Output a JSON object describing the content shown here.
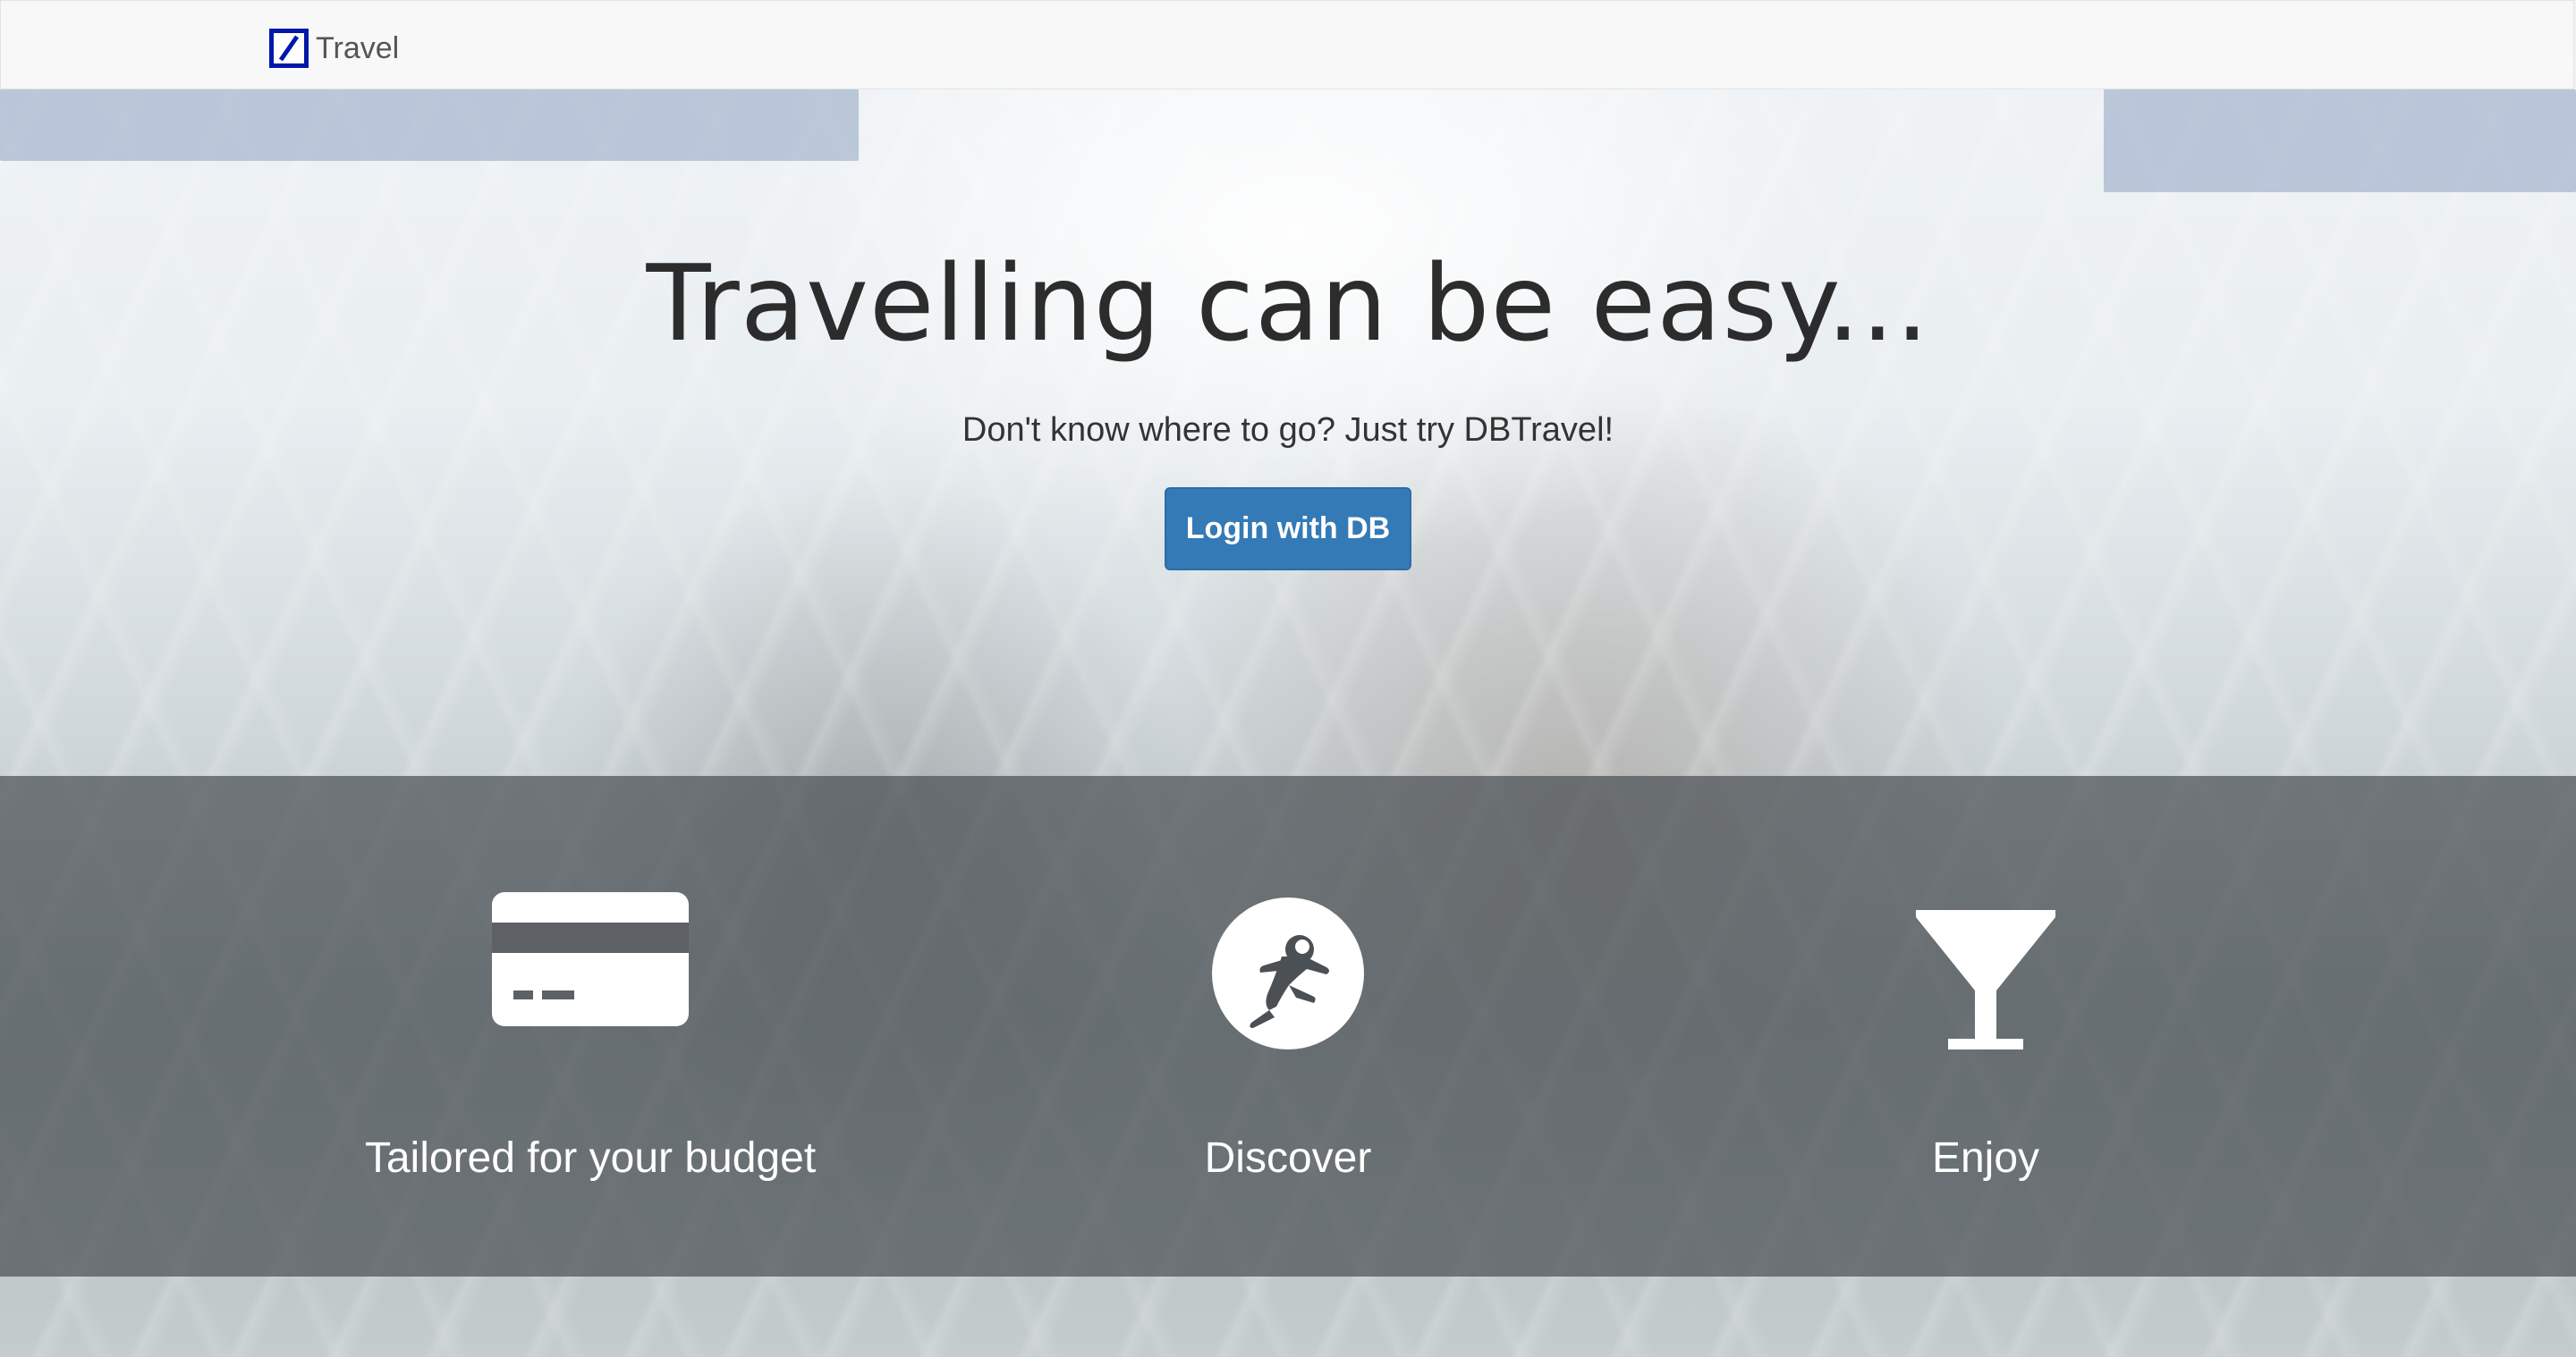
{
  "navbar": {
    "brand_label": "Travel",
    "logo_icon": "deutsche-bank-logo-icon",
    "logo_color": "#0018a8"
  },
  "hero": {
    "title": "Travelling can be easy...",
    "subtitle": "Don't know where to go? Just try DBTravel!",
    "login_button": "Login with DB",
    "button_color": "#337ab7"
  },
  "features": [
    {
      "icon": "credit-card-icon",
      "label": "Tailored for your budget"
    },
    {
      "icon": "astronaut-icon",
      "label": "Discover"
    },
    {
      "icon": "cocktail-glass-icon",
      "label": "Enjoy"
    }
  ]
}
